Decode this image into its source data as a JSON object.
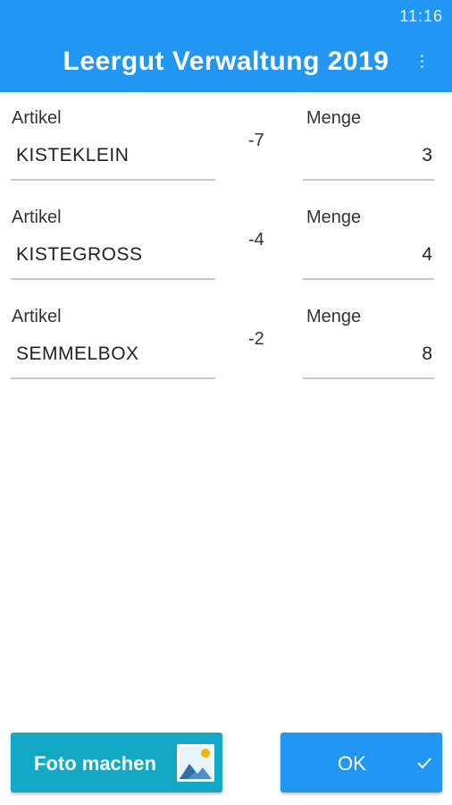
{
  "status_bar": {
    "time": "11:16"
  },
  "app_bar": {
    "title": "Leergut Verwaltung 2019",
    "menu_icon": "more-vert-icon"
  },
  "rows": [
    {
      "artikel_label": "Artikel",
      "artikel_value": "KISTEKLEIN",
      "diff": "-7",
      "menge_label": "Menge",
      "menge_value": "3"
    },
    {
      "artikel_label": "Artikel",
      "artikel_value": "KISTEGROSS",
      "diff": "-4",
      "menge_label": "Menge",
      "menge_value": "4"
    },
    {
      "artikel_label": "Artikel",
      "artikel_value": "SEMMELBOX",
      "diff": "-2",
      "menge_label": "Menge",
      "menge_value": "8"
    }
  ],
  "buttons": {
    "foto_label": "Foto machen",
    "foto_icon": "image-icon",
    "ok_label": "OK",
    "ok_icon": "check-icon"
  },
  "colors": {
    "primary": "#2196f3",
    "foto_button": "#12a8c6"
  }
}
